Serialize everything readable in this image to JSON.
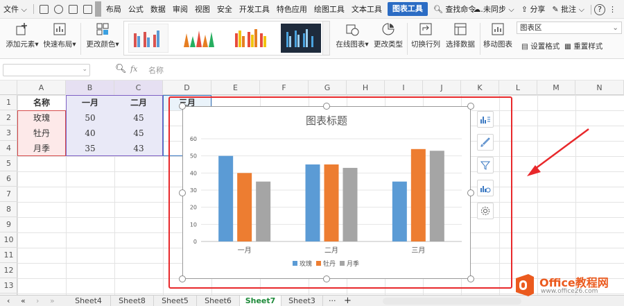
{
  "menubar": {
    "file_label": "文件",
    "tabs": [
      "布局",
      "公式",
      "数据",
      "审阅",
      "视图",
      "安全",
      "开发工具",
      "特色应用",
      "绘图工具",
      "文本工具",
      "图表工具"
    ],
    "search_placeholder": "查找命令...",
    "sync_label": "未同步",
    "share_label": "分享",
    "comment_label": "批注",
    "help_label": "?"
  },
  "ribbon": {
    "add_element": "添加元素",
    "quick_layout": "快速布局",
    "change_color": "更改颜色",
    "online_chart": "在线图表",
    "change_type": "更改类型",
    "switch_row_col": "切换行列",
    "select_data": "选择数据",
    "move_chart": "移动图表",
    "chart_area": "图表区",
    "format_setting": "设置格式",
    "reset_style": "重置样式"
  },
  "formula_bar": {
    "fx_label": "fx",
    "placeholder": "名称"
  },
  "columns": [
    "A",
    "B",
    "C",
    "D",
    "E",
    "F",
    "G",
    "H",
    "I",
    "J",
    "K",
    "L",
    "M",
    "N"
  ],
  "rows": [
    "1",
    "2",
    "3",
    "4",
    "5",
    "6",
    "7",
    "8",
    "9",
    "10",
    "11",
    "12",
    "13"
  ],
  "table": {
    "headers": [
      "名称",
      "一月",
      "二月",
      "三月"
    ],
    "rows": [
      {
        "name": "玫瑰",
        "jan": "50",
        "feb": "45"
      },
      {
        "name": "牡丹",
        "jan": "40",
        "feb": "45"
      },
      {
        "name": "月季",
        "jan": "35",
        "feb": "43"
      }
    ]
  },
  "chart_data": {
    "type": "bar",
    "title": "图表标题",
    "categories": [
      "一月",
      "二月",
      "三月"
    ],
    "series": [
      {
        "name": "玫瑰",
        "values": [
          50,
          45,
          35
        ],
        "color": "#5b9bd5"
      },
      {
        "name": "牡丹",
        "values": [
          40,
          45,
          54
        ],
        "color": "#ed7d31"
      },
      {
        "name": "月季",
        "values": [
          35,
          43,
          53
        ],
        "color": "#a5a5a5"
      }
    ],
    "ylim": [
      0,
      60
    ],
    "yticks": [
      0,
      10,
      20,
      30,
      40,
      50,
      60
    ],
    "grid": true,
    "legend": "bottom"
  },
  "sheet_tabs": [
    "Sheet4",
    "Sheet8",
    "Sheet5",
    "Sheet6",
    "Sheet7",
    "Sheet3"
  ],
  "active_tab": "Sheet7",
  "tab_more": "···",
  "tab_add": "+",
  "watermark": {
    "brand": "Office教程网",
    "url": "www.office26.com"
  },
  "colors": {
    "accent": "#2b6cc4",
    "red_annotation": "#e8282b",
    "active_tab": "#1e8a3a"
  }
}
